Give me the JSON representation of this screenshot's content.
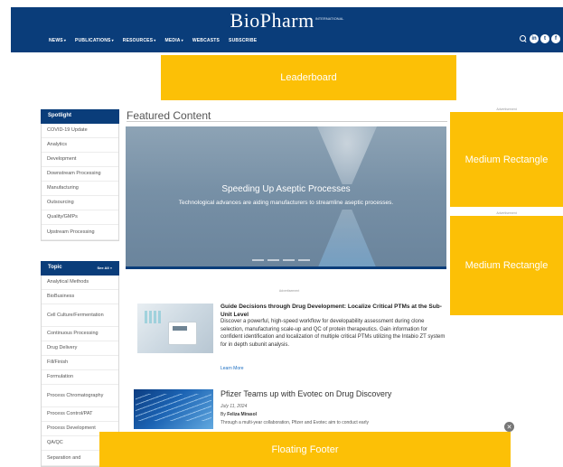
{
  "header": {
    "logo": "BioPharm",
    "logo_super": "INTERNATIONAL",
    "nav": [
      {
        "label": "NEWS",
        "caret": true
      },
      {
        "label": "PUBLICATIONS",
        "caret": true
      },
      {
        "label": "RESOURCES",
        "caret": true
      },
      {
        "label": "MEDIA",
        "caret": true
      },
      {
        "label": "WEBCASTS",
        "caret": false
      },
      {
        "label": "SUBSCRIBE",
        "caret": false
      }
    ],
    "icons": [
      "search-icon",
      "linkedin-icon",
      "twitter-icon",
      "facebook-icon"
    ]
  },
  "ads": {
    "leaderboard": "Leaderboard",
    "rect_label": "Medium Rectangle",
    "rect_caption": "Advertisement",
    "footer": "Floating Footer",
    "mid_caption": "Advertisement"
  },
  "spotlight": {
    "title": "Spotlight",
    "items": [
      "COVID-19 Update",
      "Analytics",
      "Development",
      "Downstream Processing",
      "Manufacturing",
      "Outsourcing",
      "Quality/GMPs",
      "Upstream Processing"
    ]
  },
  "topic": {
    "title": "Topic",
    "see_all": "See All »",
    "items": [
      "Analytical Methods",
      "BioBusiness",
      "Cell Culture/Fermentation",
      "Continuous Processing",
      "Drug Delivery",
      "Fill/Finish",
      "Formulation",
      "Process Chromatography",
      "Process Control/PAT",
      "Process Development",
      "QA/QC",
      "Separation and"
    ]
  },
  "featured": {
    "heading": "Featured Content",
    "hero_title": "Speeding Up Aseptic Processes",
    "hero_subtitle": "Technological advances are aiding manufacturers to streamline aseptic processes.",
    "slides": 4
  },
  "article1": {
    "title": "Guide Decisions through Drug Development: Localize Critical PTMs at the Sub-Unit Level",
    "body": "Discover a powerful, high-speed workflow for developability assessment during clone selection, manufacturing scale-up and QC of protein therapeutics. Gain information for confident identification and localization of multiple critical PTMs utilizing the Intabio ZT system for in depth subunit analysis.",
    "link": "Learn More"
  },
  "article2": {
    "title": "Pfizer Teams up with Evotec on Drug Discovery",
    "date": "July 11, 2024",
    "author_prefix": "By",
    "author": "Feliza Mirasol",
    "body": "Through a multi-year collaboration, Pfizer and Evotec aim to conduct early"
  },
  "colors": {
    "brand_navy": "#0a3d7a",
    "ad_yellow": "#fcc006",
    "link_blue": "#1b6ec2"
  }
}
